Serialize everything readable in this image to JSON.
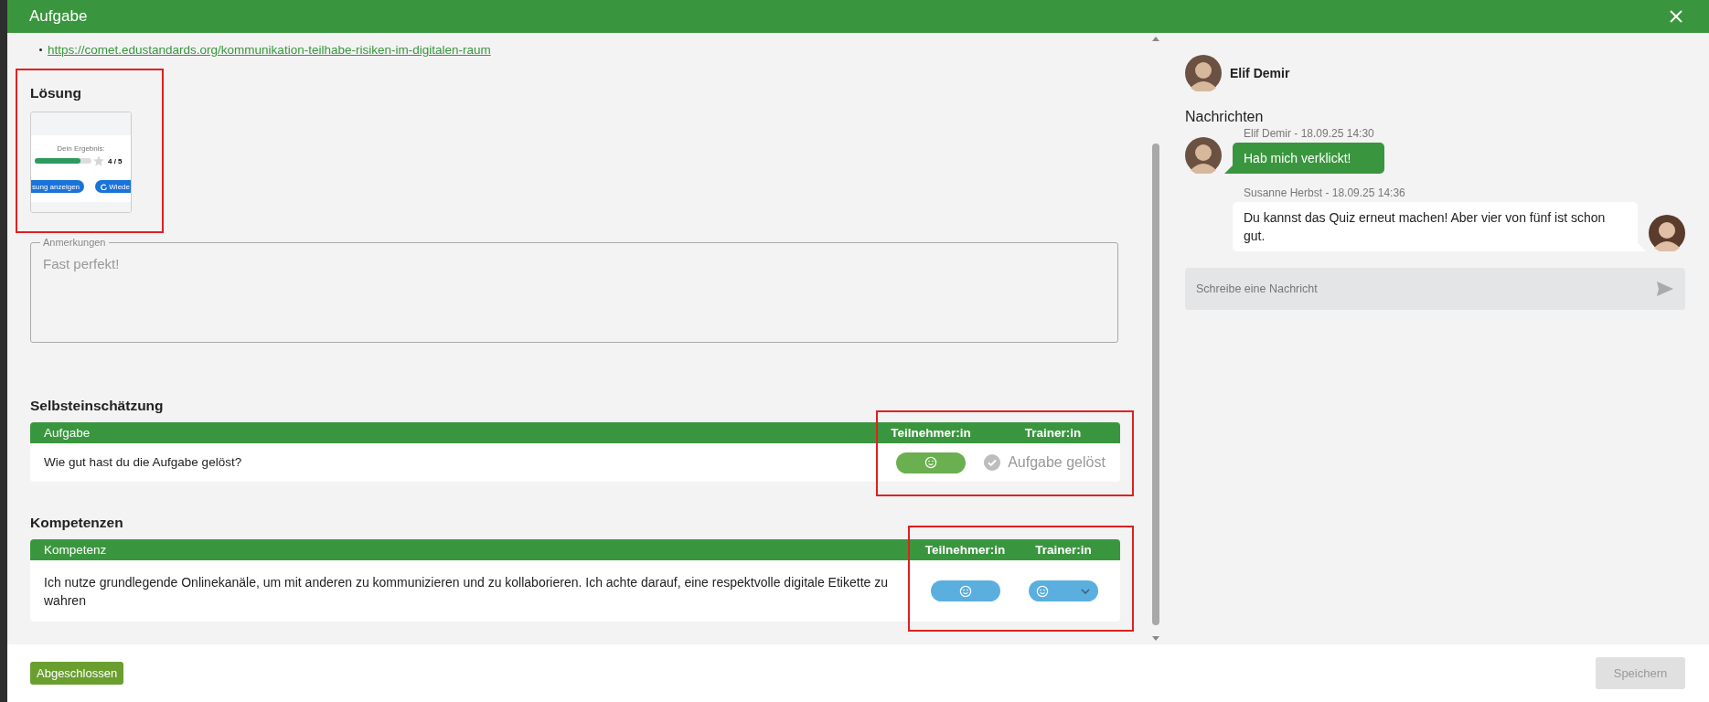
{
  "window": {
    "title": "Aufgabe"
  },
  "link": "https://comet.edustandards.org/kommunikation-teilhabe-risiken-im-digitalen-raum",
  "solution": {
    "heading": "Lösung",
    "highlighted": true,
    "thumbnail": {
      "caption": "Dein Ergebnis:",
      "level": 0.8,
      "score": "4 / 5",
      "buttons": [
        "sung anzeigen",
        "Wiede"
      ]
    }
  },
  "notes": {
    "label": "Anmerkungen",
    "value": "Fast perfekt!"
  },
  "self_assessment": {
    "heading": "Selbsteinschätzung",
    "highlighted": true,
    "columns": [
      "Aufgabe",
      "Teilnehmer:in",
      "Trainer:in"
    ],
    "rows": [
      {
        "text": "Wie gut hast du die Aufgabe gelöst?",
        "participant": {
          "kind": "pill",
          "color": "#6aaf50"
        },
        "trainer": {
          "kind": "status",
          "label": "Aufgabe gelöst"
        }
      }
    ]
  },
  "competences": {
    "heading": "Kompetenzen",
    "highlighted": true,
    "columns": [
      "Kompetenz",
      "Teilnehmer:in",
      "Trainer:in"
    ],
    "rows": [
      {
        "text": "Ich nutze grundlegende Onlinekanäle, um mit anderen zu kommunizieren und zu kollaborieren. Ich achte darauf, eine respektvolle digitale Etikette zu wahren",
        "participant": {
          "kind": "pill",
          "color": "#5aafdf"
        },
        "trainer": {
          "kind": "select",
          "color": "#5aafdf"
        }
      }
    ]
  },
  "chat": {
    "user": "Elif Demir",
    "heading": "Nachrichten",
    "messages": [
      {
        "kind": "incoming",
        "meta": "Elif Demir - 18.09.25 14:30",
        "text": "Hab mich verklickt!",
        "color": "#3a963e"
      },
      {
        "kind": "outgoing",
        "meta": "Susanne Herbst - 18.09.25 14:36",
        "text": "Du kannst das Quiz erneut machen! Aber vier von fünf ist schon gut.",
        "color": "#ffffff"
      }
    ],
    "input": {
      "placeholder": "Schreibe eine Nachricht"
    }
  },
  "footer": {
    "status": "Abgeschlossen",
    "save": {
      "label": "Speichern",
      "disabled": true
    }
  }
}
